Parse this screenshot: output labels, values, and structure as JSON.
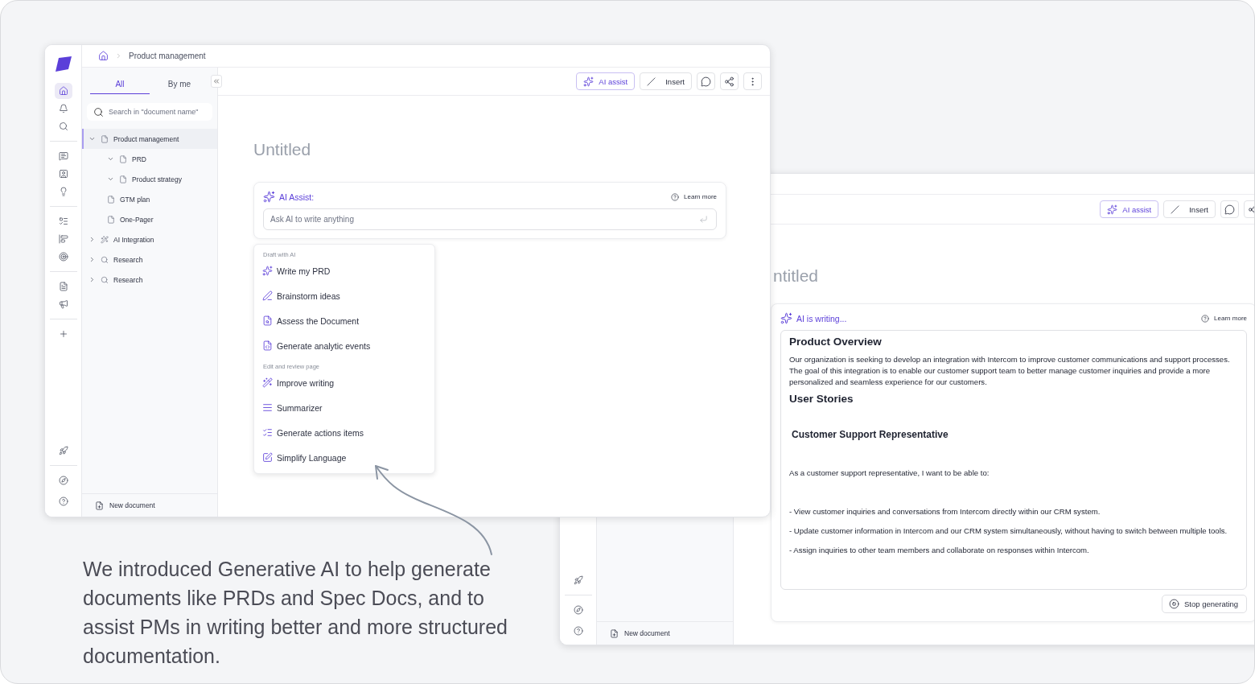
{
  "back_window": {
    "toolbar": {
      "ai_assist": "AI assist",
      "insert": "Insert"
    },
    "title": "ntitled",
    "ai_panel": {
      "label": "AI is writing...",
      "learn_more": "Learn more",
      "content": [
        {
          "kind": "heading",
          "text": "Product Overview"
        },
        {
          "kind": "paragraph",
          "text": "Our organization is seeking to develop an integration with Intercom to improve customer communications and support processes. The goal of this integration is to enable our customer support team to better manage customer inquiries and provide a more personalized and seamless experience for our customers."
        },
        {
          "kind": "heading",
          "text": "User Stories"
        },
        {
          "kind": "subheading",
          "text": "Customer Support Representative"
        },
        {
          "kind": "paragraph",
          "text": "As a customer support representative, I want to be able to:"
        },
        {
          "kind": "bullet",
          "text": "- View customer inquiries and conversations from Intercom directly within our CRM system."
        },
        {
          "kind": "bullet",
          "text": "- Update customer information in Intercom and our CRM system simultaneously, without having to switch between multiple tools."
        },
        {
          "kind": "bullet",
          "text": "- Assign inquiries to other team members and collaborate on responses within Intercom."
        }
      ],
      "stop_button": "Stop generating"
    },
    "sidebar": {
      "new_document": "New document"
    }
  },
  "front_window": {
    "breadcrumb": "Product management",
    "rail": [
      [
        {
          "selected": true
        },
        {
          "selected": false
        },
        {
          "selected": false
        }
      ],
      [
        {
          "selected": false
        },
        {
          "selected": false
        },
        {
          "selected": false
        }
      ],
      [
        {
          "selected": false
        },
        {
          "selected": false
        },
        {
          "selected": false
        }
      ],
      [
        {
          "selected": false
        },
        {
          "selected": false
        }
      ],
      [
        {
          "selected": false
        }
      ]
    ],
    "sidebar": {
      "tabs": [
        {
          "label": "All",
          "selected": true
        },
        {
          "label": "By me",
          "selected": false
        }
      ],
      "search": {
        "placeholder": "Search in \"document name\""
      },
      "tree": [
        {
          "label": "Product management",
          "kind": "page",
          "expanded": true,
          "selected": true,
          "children": [
            {
              "label": "PRD",
              "kind": "page",
              "expanded": true,
              "selected": false
            },
            {
              "label": "Product strategy",
              "kind": "page",
              "expanded": true,
              "selected": false
            },
            {
              "label": "GTM plan",
              "kind": "page",
              "selected": false
            },
            {
              "label": "One-Pager",
              "kind": "page",
              "selected": false
            }
          ]
        },
        {
          "label": "AI Integration",
          "kind": "wand",
          "expanded": false,
          "selected": false
        },
        {
          "label": "Research",
          "kind": "search",
          "expanded": false,
          "selected": false
        },
        {
          "label": "Research",
          "kind": "search",
          "expanded": false,
          "selected": false
        }
      ],
      "new_document": "New document"
    },
    "toolbar": {
      "ai_assist": "AI assist",
      "insert": "Insert"
    },
    "title": "Untitled",
    "ai_panel": {
      "label": "AI Assist:",
      "learn_more": "Learn more",
      "input": {
        "placeholder": "Ask AI to write anything"
      }
    },
    "menu": {
      "sections": [
        {
          "title": "Draft with AI",
          "items": [
            "Write my PRD",
            "Brainstorm ideas",
            "Assess the Document",
            "Generate analytic events"
          ]
        },
        {
          "title": "Edit and review page",
          "items": [
            "Improve writing",
            "Summarizer",
            "Generate actions items",
            "Simplify Language"
          ]
        }
      ]
    }
  },
  "caption": "We introduced Generative AI to help generate documents like PRDs and Spec Docs, and to assist PMs in writing better and more structured documentation."
}
